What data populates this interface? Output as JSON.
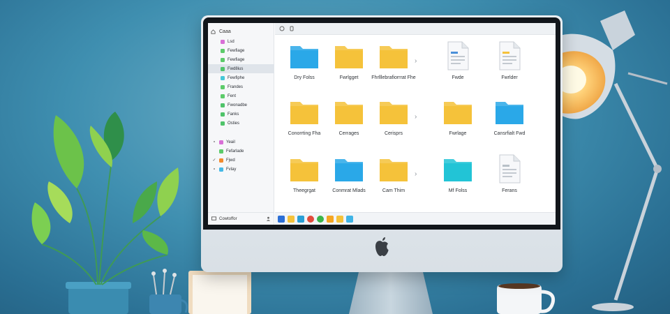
{
  "window": {
    "sidebar": {
      "title": "Caaa",
      "items": [
        {
          "label": "Lsd",
          "color": "#d86fd6"
        },
        {
          "label": "Fewfiage",
          "color": "#5ccb6a"
        },
        {
          "label": "Fewfiage",
          "color": "#5ccb6a"
        },
        {
          "label": "Fwd8ius",
          "color": "#4fc36a",
          "selected": true
        },
        {
          "label": "Fewfiphe",
          "color": "#45c8d8"
        },
        {
          "label": "Frandes",
          "color": "#5ccb6a"
        },
        {
          "label": "Fent",
          "color": "#5ccb6a"
        },
        {
          "label": "Fwonadbe",
          "color": "#4fc36a"
        },
        {
          "label": "Fanks",
          "color": "#4fc36a"
        },
        {
          "label": "Osties",
          "color": "#4fc36a"
        }
      ],
      "secondary_items": [
        {
          "mark": "∘",
          "label": "Yeail",
          "color": "#d86fd6"
        },
        {
          "mark": "",
          "label": "Fefarlade",
          "color": "#5ccb6a"
        },
        {
          "mark": "✓",
          "label": "Fjwd",
          "color": "#f28a2e"
        },
        {
          "mark": "∘",
          "label": "Fvlay",
          "color": "#45b8e6"
        }
      ],
      "footer_label": "Cowtoffor",
      "footer_icon": "person-icon"
    },
    "topbar": {
      "icons": [
        "back-icon",
        "search-icon"
      ]
    },
    "files": [
      {
        "label": "Dry Folss",
        "type": "folder",
        "color": "#2aa8e8"
      },
      {
        "label": "Fwrlgget",
        "type": "folder",
        "color": "#f5c23a"
      },
      {
        "label": "Fhrlllebrafiorrrat Fhe",
        "type": "folder",
        "color": "#f5c23a"
      },
      {
        "label": "Fwde",
        "type": "document",
        "color": "#4a90d9"
      },
      {
        "label": "Fwrlder",
        "type": "document",
        "color": "#f5c23a"
      },
      {
        "label": "Conorrting Fha",
        "type": "folder",
        "color": "#f5c23a"
      },
      {
        "label": "Cerrages",
        "type": "folder",
        "color": "#f5c23a"
      },
      {
        "label": "Cerisprs",
        "type": "folder",
        "color": "#f5c23a"
      },
      {
        "label": "Fwrlage",
        "type": "folder",
        "color": "#f5c23a"
      },
      {
        "label": "Cansrfialt Fwd",
        "type": "folder",
        "color": "#2aa8e8"
      },
      {
        "label": "Theegrgat",
        "type": "folder",
        "color": "#f5c23a"
      },
      {
        "label": "Conmrat Mlads",
        "type": "folder",
        "color": "#2aa8e8"
      },
      {
        "label": "Cam Thim",
        "type": "folder",
        "color": "#f5c23a"
      },
      {
        "label": "Mf Folss",
        "type": "folder",
        "color": "#22c4d6"
      },
      {
        "label": "Ferans",
        "type": "document",
        "color": "#b8c0c8"
      }
    ],
    "taskbar_icons": [
      {
        "name": "start-icon",
        "color": "#2c6fd6"
      },
      {
        "name": "folder-icon",
        "color": "#f5c23a"
      },
      {
        "name": "files-icon",
        "color": "#2a9fd6"
      },
      {
        "name": "chrome-icon",
        "color": "#e24b3b"
      },
      {
        "name": "edge-icon",
        "color": "#3bb54a"
      },
      {
        "name": "store-icon",
        "color": "#f5a623"
      },
      {
        "name": "mail-icon",
        "color": "#f5c23a"
      },
      {
        "name": "app-icon",
        "color": "#40b4e6"
      }
    ]
  }
}
